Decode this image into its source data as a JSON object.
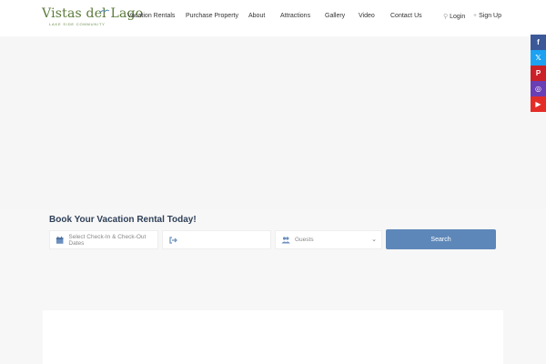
{
  "brand": {
    "name": "Vistas del Lago",
    "tagline": "LAKE SIDE COMMUNITY",
    "color": "#5a7a3a"
  },
  "nav": {
    "items": [
      {
        "label": "Vacation Rentals"
      },
      {
        "label": "Purchase Property"
      },
      {
        "label": "About"
      },
      {
        "label": "Attractions"
      },
      {
        "label": "Gallery"
      },
      {
        "label": "Video"
      },
      {
        "label": "Contact Us"
      }
    ],
    "login_label": "Login",
    "signup_label": "Sign Up"
  },
  "social": [
    {
      "name": "facebook-icon",
      "glyph": "f",
      "color": "#3b5998"
    },
    {
      "name": "x-twitter-icon",
      "glyph": "𝕏",
      "color": "#1da1f2"
    },
    {
      "name": "pinterest-icon",
      "glyph": "P",
      "color": "#cb2027"
    },
    {
      "name": "instagram-icon",
      "glyph": "◎",
      "color": "#6a3fb5"
    },
    {
      "name": "youtube-icon",
      "glyph": "▶",
      "color": "#e52d27"
    }
  ],
  "booking": {
    "title": "Book Your Vacation Rental Today!",
    "dates_placeholder": "Select Check-In & Check-Out Dates",
    "checkout_placeholder": "",
    "guests_placeholder": "Guests",
    "search_label": "Search",
    "accent": "#5e87b9"
  }
}
